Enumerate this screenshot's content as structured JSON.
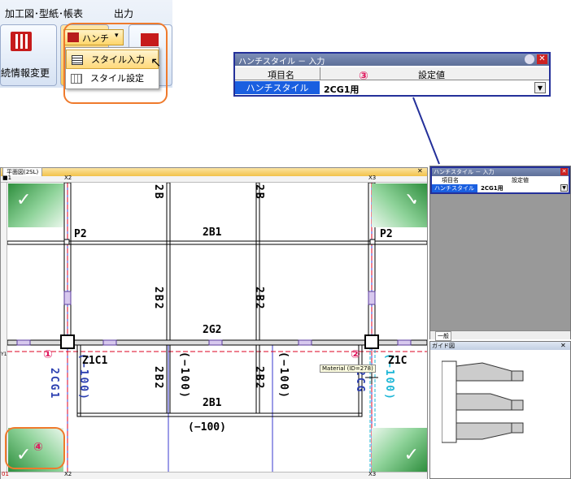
{
  "ribbon": {
    "tab1": "加工図･型紙･帳表",
    "tab2": "出力",
    "left_label": "続情報変更",
    "dropdown_button": "ハンチ",
    "menu": [
      "スタイル入力",
      "スタイル設定"
    ]
  },
  "style_window": {
    "title": "ハンチスタイル － 入力",
    "col1": "項目名",
    "col2": "設定値",
    "row_name": "ハンチスタイル",
    "row_value": "2CG1用",
    "annotation": "③"
  },
  "small_window": {
    "title": "ハンチスタイル － 入力",
    "col1": "項目名",
    "col2": "設定値",
    "row_name": "ハンチスタイル",
    "row_value": "2CG1用",
    "footer": "一般"
  },
  "guide_panel": {
    "title": "ガイド図"
  },
  "cad": {
    "tab_title": "平面図(2SL)",
    "row_label": "Y1",
    "x_left": "X2",
    "x_right": "X3",
    "top_left_small": "■1",
    "bottom_left_small": "01",
    "labels": {
      "p2_left": "P2",
      "p2_right": "P2",
      "b1_top": "2B1",
      "g2": "2G2",
      "b1_bottom": "2B1",
      "minus100_h": "(−100)",
      "b_top_left": "2B",
      "b_top_right": "2B",
      "b2_mid_left": "2B2",
      "b2_mid_right": "2B2",
      "b2_low_left": "2B2",
      "b2_low_right": "2B2",
      "v_minus_left": "(−100)",
      "v_minus_mid": "(−100)",
      "v_minus_midright": "(−100)",
      "v_minus_right": "(−100)",
      "cg1_left": "2CG1",
      "cg1_right": "2CG",
      "c1_left": "Z1C1",
      "c1_right": "Z1C",
      "tooltip": "Material (ID=278)"
    },
    "annotations": [
      "①",
      "②",
      "④"
    ]
  },
  "colors": {
    "accent_orange": "#ef7a2c",
    "window_border": "#24309a",
    "select_blue": "#1a5fe0",
    "marker_pink": "#e0185e"
  }
}
